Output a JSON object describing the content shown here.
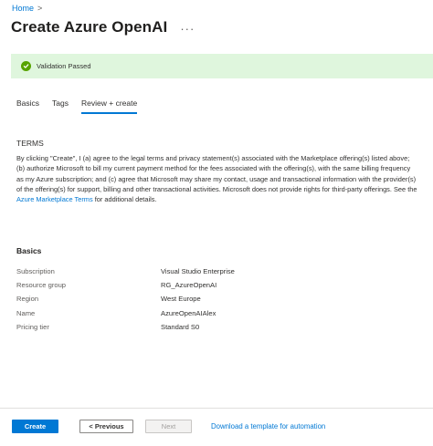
{
  "breadcrumb": {
    "home": "Home",
    "separator": ">"
  },
  "header": {
    "title": "Create Azure OpenAI",
    "more": "···"
  },
  "validation": {
    "text": "Validation Passed",
    "status_color": "#57a300"
  },
  "tabs": [
    {
      "label": "Basics",
      "active": false
    },
    {
      "label": "Tags",
      "active": false
    },
    {
      "label": "Review + create",
      "active": true
    }
  ],
  "terms": {
    "heading": "TERMS",
    "text_before_link": "By clicking \"Create\", I (a) agree to the legal terms and privacy statement(s) associated with the Marketplace offering(s) listed above; (b) authorize Microsoft to bill my current payment method for the fees associated with the offering(s), with the same billing frequency as my Azure subscription; and (c) agree that Microsoft may share my contact, usage and transactional information with the provider(s) of the offering(s) for support, billing and other transactional activities. Microsoft does not provide rights for third-party offerings. See the ",
    "link_text": "Azure Marketplace Terms",
    "text_after_link": " for additional details."
  },
  "basics": {
    "heading": "Basics",
    "rows": [
      {
        "label": "Subscription",
        "value": "Visual Studio Enterprise"
      },
      {
        "label": "Resource group",
        "value": "RG_AzureOpenAI"
      },
      {
        "label": "Region",
        "value": "West Europe"
      },
      {
        "label": "Name",
        "value": "AzureOpenAIAlex"
      },
      {
        "label": "Pricing tier",
        "value": "Standard S0"
      }
    ]
  },
  "footer": {
    "create": "Create",
    "previous": "< Previous",
    "next": "Next",
    "download": "Download a template for automation"
  }
}
